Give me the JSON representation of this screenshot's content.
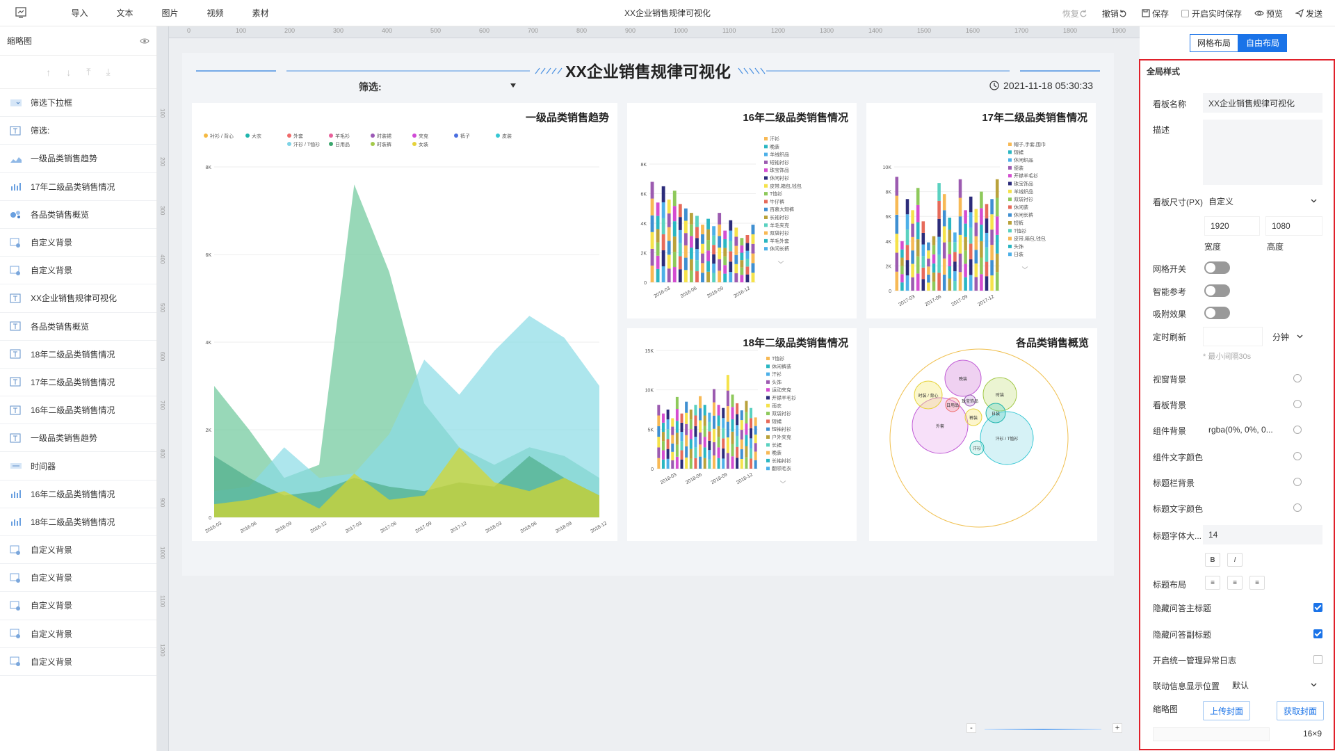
{
  "app": {
    "title": "XX企业销售规律可视化"
  },
  "menu": [
    "导入",
    "文本",
    "图片",
    "视频",
    "素材"
  ],
  "toolbar": {
    "restore": "恢复",
    "undo": "撤销",
    "save": "保存",
    "realtime": "开启实时保存",
    "preview": "预览",
    "publish": "发送"
  },
  "left_panel": {
    "title": "缩略图",
    "layers": [
      {
        "label": "筛选下拉框",
        "icon": "dropdown-icon"
      },
      {
        "label": "筛选:",
        "icon": "text-icon"
      },
      {
        "label": "一级品类销售趋势",
        "icon": "area-chart-icon"
      },
      {
        "label": "17年二级品类销售情况",
        "icon": "bar-chart-icon"
      },
      {
        "label": "各品类销售概览",
        "icon": "bubble-chart-icon"
      },
      {
        "label": "自定义背景",
        "icon": "background-icon"
      },
      {
        "label": "自定义背景",
        "icon": "background-icon"
      },
      {
        "label": "XX企业销售规律可视化",
        "icon": "text-icon"
      },
      {
        "label": "各品类销售概览",
        "icon": "text-icon"
      },
      {
        "label": "18年二级品类销售情况",
        "icon": "text-icon"
      },
      {
        "label": "17年二级品类销售情况",
        "icon": "text-icon"
      },
      {
        "label": "16年二级品类销售情况",
        "icon": "text-icon"
      },
      {
        "label": "一级品类销售趋势",
        "icon": "text-icon"
      },
      {
        "label": "时间器",
        "icon": "timer-icon"
      },
      {
        "label": "16年二级品类销售情况",
        "icon": "bar-chart-icon"
      },
      {
        "label": "18年二级品类销售情况",
        "icon": "bar-chart-icon"
      },
      {
        "label": "自定义背景",
        "icon": "background-icon"
      },
      {
        "label": "自定义背景",
        "icon": "background-icon"
      },
      {
        "label": "自定义背景",
        "icon": "background-icon"
      },
      {
        "label": "自定义背景",
        "icon": "background-icon"
      },
      {
        "label": "自定义背景",
        "icon": "background-icon"
      }
    ]
  },
  "ruler": {
    "ticks": [
      "0",
      "100",
      "200",
      "300",
      "400",
      "500",
      "600",
      "700",
      "800",
      "900",
      "1000",
      "1100",
      "1200",
      "1300",
      "1400",
      "1500",
      "1600",
      "1700",
      "1800",
      "1900"
    ],
    "vticks": [
      "100",
      "200",
      "300",
      "400",
      "500",
      "600",
      "700",
      "800",
      "900",
      "1000",
      "1100",
      "1200"
    ]
  },
  "dashboard": {
    "title": "XX企业销售规律可视化",
    "filter_label": "筛选:",
    "datetime": "2021-11-18 05:30:33",
    "panels": {
      "trend": "一级品类销售趋势",
      "y16": "16年二级品类销售情况",
      "y17": "17年二级品类销售情况",
      "y18": "18年二级品类销售情况",
      "overview": "各品类销售概览"
    }
  },
  "chart_data": [
    {
      "type": "area",
      "title": "一级品类销售趋势",
      "x": [
        "2016-03",
        "2016-06",
        "2016-09",
        "2016-12",
        "2017-03",
        "2017-06",
        "2017-09",
        "2017-12",
        "2018-03",
        "2018-06",
        "2018-09",
        "2018-12"
      ],
      "ylim": [
        0,
        8000
      ],
      "yticks": [
        "0",
        "2K",
        "4K",
        "6K",
        "8K"
      ],
      "legend": [
        "衬衫 / 背心",
        "大衣",
        "外套",
        "羊毛衫",
        "时装裙",
        "夹克",
        "裤子",
        "皮装",
        "汗衫 / T恤衫",
        "日用品",
        "时装裤",
        "女装"
      ],
      "colors": [
        "#f5b942",
        "#1fb5ad",
        "#ef6a6a",
        "#e8609a",
        "#9b59b6",
        "#d04ad6",
        "#4a6ee0",
        "#35c7d3",
        "#7ed3e6",
        "#3aa66d",
        "#a3c94a",
        "#e6d23a"
      ],
      "series": [
        {
          "name": "日用品",
          "color": "#6cc79a",
          "values": [
            3000,
            2000,
            900,
            1200,
            7600,
            5600,
            2600,
            1600,
            1200,
            1600,
            1400,
            900
          ]
        },
        {
          "name": "汗衫 / T恤衫",
          "color": "#8adbe6",
          "values": [
            600,
            700,
            1600,
            900,
            1000,
            1900,
            3600,
            2800,
            3800,
            4600,
            4100,
            3000
          ]
        },
        {
          "name": "时装裤",
          "color": "#4fae8a",
          "values": [
            1400,
            900,
            500,
            600,
            900,
            700,
            600,
            800,
            700,
            1400,
            900,
            500
          ]
        },
        {
          "name": "女装",
          "color": "#d8d62a",
          "values": [
            300,
            400,
            600,
            200,
            1000,
            400,
            500,
            1600,
            800,
            600,
            900,
            500
          ]
        }
      ]
    },
    {
      "type": "bar",
      "title": "16年二级品类销售情况",
      "x": [
        "2016-03",
        "2016-06",
        "2016-09",
        "2016-12"
      ],
      "ylim": [
        0,
        8000
      ],
      "yticks": [
        "0",
        "2K",
        "4K",
        "6K",
        "8K"
      ],
      "legend": [
        "汗衫",
        "晚装",
        "羊绒织品",
        "短袖衬衫",
        "珠宝饰品",
        "休闲衬衫",
        "皮带,箱包,钱包",
        "T恤衫",
        "牛仔裤",
        "百慕大短裤",
        "长袖衬衫",
        "羊毛夹克",
        "双袋衬衫",
        "羊毛外套",
        "休闲长裤"
      ],
      "values": [
        6800,
        5400,
        6500,
        5600,
        6200,
        5300,
        5000,
        4700,
        4500,
        3900,
        4300,
        3800,
        4700,
        3500,
        4200,
        3700,
        3000,
        3200,
        3900
      ]
    },
    {
      "type": "bar",
      "title": "17年二级品类销售情况",
      "x": [
        "2017-03",
        "2017-06",
        "2017-09",
        "2017-12"
      ],
      "ylim": [
        0,
        10000
      ],
      "yticks": [
        "0",
        "2K",
        "4K",
        "6K",
        "8K",
        "10K"
      ],
      "legend": [
        "帽子,手套,围巾",
        "短裙",
        "休闲织品",
        "便装",
        "开襟羊毛衫",
        "珠宝饰品",
        "羊绒织品",
        "双袋衬衫",
        "休闲装",
        "休闲长裤",
        "短裤",
        "T恤衫",
        "皮带,箱包,钱包",
        "头饰",
        "日装"
      ],
      "values": [
        9200,
        4000,
        7400,
        6500,
        8300,
        5600,
        3900,
        4400,
        8700,
        7800,
        5900,
        4700,
        9000,
        6500,
        7600,
        6600,
        8000,
        7000,
        7400,
        9000
      ]
    },
    {
      "type": "bar",
      "title": "18年二级品类销售情况",
      "x": [
        "2018-03",
        "2018-06",
        "2018-09",
        "2018-12"
      ],
      "ylim": [
        0,
        15000
      ],
      "yticks": [
        "0",
        "5K",
        "10K",
        "15K"
      ],
      "legend": [
        "T恤衫",
        "休闲裤装",
        "汗衫",
        "头饰",
        "运动夹克",
        "开襟羊毛衫",
        "雨衣",
        "双袋衬衫",
        "短裙",
        "短袖衬衫",
        "户外夹克",
        "长裙",
        "晚装",
        "长袖衬衫",
        "翻领毛衣"
      ],
      "values": [
        8100,
        7000,
        7500,
        6400,
        9100,
        7000,
        8500,
        7500,
        8100,
        9200,
        8100,
        7100,
        10100,
        8100,
        7700,
        11900,
        9400,
        8300,
        7400,
        8600,
        7700,
        6500
      ]
    },
    {
      "type": "bubble",
      "title": "各品类销售概览",
      "labels": [
        "晚装",
        "时装 / 背心",
        "外套",
        "日装",
        "裤装",
        "日用品",
        "珠宝饰品",
        "汗衫",
        "汗衫 / T恤衫",
        "时装"
      ]
    }
  ],
  "right_panel": {
    "tabs": [
      "网格布局",
      "自由布局"
    ],
    "section": "全局样式",
    "board_name_label": "看板名称",
    "board_name": "XX企业销售规律可视化",
    "desc_label": "描述",
    "size_label": "看板尺寸(PX)",
    "size_mode": "自定义",
    "width": "1920",
    "height": "1080",
    "width_label": "宽度",
    "height_label": "高度",
    "grid_label": "网格开关",
    "smart_label": "智能参考",
    "snap_label": "吸附效果",
    "refresh_label": "定时刷新",
    "refresh_unit": "分钟",
    "refresh_hint": "* 最小间隔30s",
    "window_bg": "视窗背景",
    "board_bg": "看板背景",
    "comp_bg": "组件背景",
    "comp_bg_val": "rgba(0%, 0%, 0...",
    "comp_text": "组件文字颜色",
    "titlebar_bg": "标题栏背景",
    "title_color": "标题文字颜色",
    "title_size_label": "标题字体大...",
    "title_size": "14",
    "title_layout": "标题布局",
    "hide_main": "隐藏问答主标题",
    "hide_sub": "隐藏问答副标题",
    "log_label": "开启统一管理异常日志",
    "link_label": "联动信息显示位置",
    "link_val": "默认",
    "thumb_label": "缩略图",
    "upload_cover": "上传封面",
    "get_cover": "获取封面",
    "ratio": "16×9"
  }
}
